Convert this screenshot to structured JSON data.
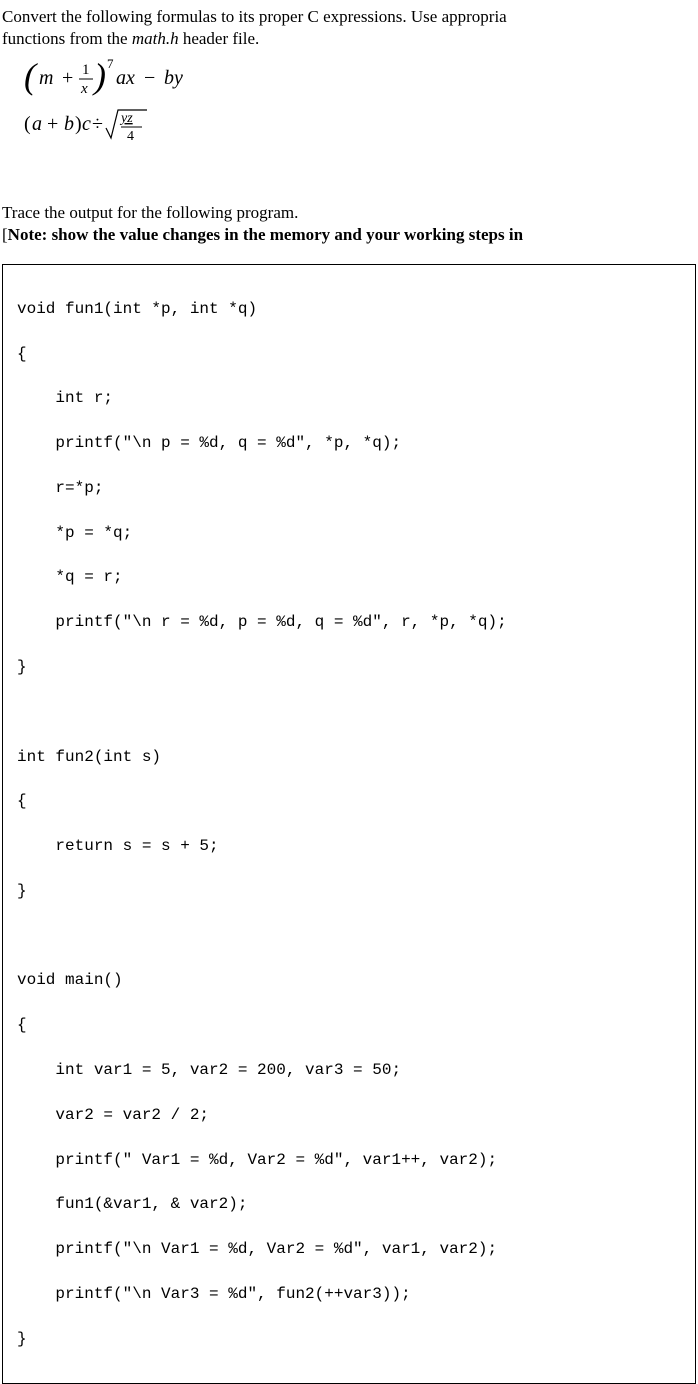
{
  "q1": {
    "prompt_line1": "Convert the following formulas to its proper C expressions. Use appropria",
    "prompt_line2_prefix": "functions from the ",
    "prompt_line2_italic": "math.h",
    "prompt_line2_suffix": " header file."
  },
  "q2": {
    "prompt": "Trace the output for the following program.",
    "note_prefix": "[Note: show the value changes in the memory and your working steps in"
  },
  "code": {
    "l1": "void fun1(int *p, int *q)",
    "l2": "{",
    "l3": "    int r;",
    "l4": "    printf(\"\\n p = %d, q = %d\", *p, *q);",
    "l5": "    r=*p;",
    "l6": "    *p = *q;",
    "l7": "    *q = r;",
    "l8": "    printf(\"\\n r = %d, p = %d, q = %d\", r, *p, *q);",
    "l9": "}",
    "l11": "int fun2(int s)",
    "l12": "{",
    "l13": "    return s = s + 5;",
    "l14": "}",
    "l16": "void main()",
    "l17": "{",
    "l18": "    int var1 = 5, var2 = 200, var3 = 50;",
    "l19": "    var2 = var2 / 2;",
    "l20": "    printf(\" Var1 = %d, Var2 = %d\", var1++, var2);",
    "l21": "    fun1(&var1, & var2);",
    "l22": "    printf(\"\\n Var1 = %d, Var2 = %d\", var1, var2);",
    "l23": "    printf(\"\\n Var3 = %d\", fun2(++var3));",
    "l24": "}"
  },
  "formula": {
    "m": "m",
    "plus": "+",
    "one": "1",
    "x": "x",
    "seven": "7",
    "ax": "ax",
    "minus": "−",
    "by": "by",
    "a_plus_b": "a",
    "b": "b",
    "c": "c",
    "div": "÷",
    "yz": "yz",
    "four": "4"
  }
}
